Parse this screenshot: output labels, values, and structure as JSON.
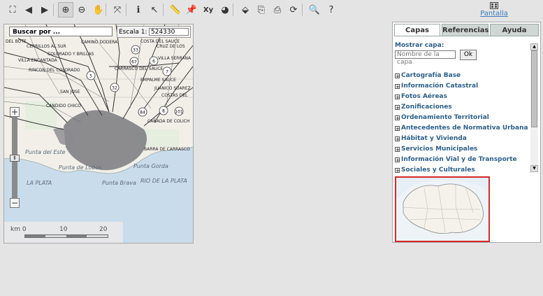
{
  "toolbar": {
    "buttons": [
      {
        "name": "extent-icon",
        "glyph": "⛶"
      },
      {
        "name": "back-arrow-icon",
        "glyph": "◀"
      },
      {
        "name": "forward-arrow-icon",
        "glyph": "▶"
      },
      {
        "name": "zoom-in-icon",
        "glyph": "⊕"
      },
      {
        "name": "zoom-out-icon",
        "glyph": "⊖"
      },
      {
        "name": "pan-hand-icon",
        "glyph": "✋"
      },
      {
        "name": "zoom-window-icon",
        "glyph": "⤧"
      },
      {
        "name": "info-icon",
        "glyph": "ℹ"
      },
      {
        "name": "select-arrow-icon",
        "glyph": "↖"
      },
      {
        "name": "measure-ruler-icon",
        "glyph": "📏"
      },
      {
        "name": "pushpin-icon",
        "glyph": "📌"
      },
      {
        "name": "coordinates-icon",
        "glyph": "Xy"
      },
      {
        "name": "globe-icon",
        "glyph": "◕"
      },
      {
        "name": "fill-bucket-icon",
        "glyph": "⬙"
      },
      {
        "name": "export-icon",
        "glyph": "⎘"
      },
      {
        "name": "print-icon",
        "glyph": "⎙"
      },
      {
        "name": "refresh-icon",
        "glyph": "⟳"
      },
      {
        "name": "search-globe-icon",
        "glyph": "🔍"
      },
      {
        "name": "help-icon",
        "glyph": "?"
      }
    ],
    "pantalla_label": "Pantalla"
  },
  "map": {
    "search_label": "Buscar por ...",
    "scale_label": "Escala 1:",
    "scale_value": "524330",
    "places": [
      "DEL BOTE",
      "CERRILLOS AL SUR",
      "CAMINO DODERA",
      "COSTA DEL SAUCE",
      "CRUZ DE LOS",
      "COLORADO Y BRILLAS",
      "VILLA SERRANA",
      "VILLA ENCANTADA",
      "RINCON DEL COLORADO",
      "CARRASCO DEL SAUCE",
      "EMPALME SAUCE",
      "JUANICO SUAREZ",
      "COSTAS DEL",
      "CAÑADA DE COLICH",
      "Punta del Este",
      "Punta de Lobos",
      "Punta Gorda",
      "Punta Brava",
      "RIO DE LA PLATA",
      "LA PLATA",
      "BARRA DE CARRASCO",
      "CANDIDO CHICO",
      "SAN JOSE"
    ],
    "route_numbers": [
      "33",
      "67",
      "6",
      "5",
      "32",
      "7",
      "84",
      "8",
      "101"
    ],
    "scalebar": {
      "unit": "km",
      "ticks": [
        "0",
        "10",
        "20"
      ]
    }
  },
  "panel": {
    "tabs": [
      {
        "label": "Capas",
        "active": true
      },
      {
        "label": "Referencias",
        "active": false
      },
      {
        "label": "Ayuda",
        "active": false
      }
    ],
    "show_layer_label": "Mostrar capa:",
    "layer_name_placeholder": "Nombre de la capa",
    "ok_label": "Ok",
    "layers": [
      "Cartografía Base",
      "Información Catastral",
      "Fotos Aéreas",
      "Zonificaciones",
      "Ordenamiento Territorial",
      "Antecedentes de Normativa Urbana",
      "Hábitat y Vivienda",
      "Servicios Municipales",
      "Información Vial y de Transporte",
      "Sociales y Culturales"
    ]
  },
  "colors": {
    "water": "#c9dcec",
    "land": "#f1efe8",
    "urban": "#6f6f73",
    "road": "#3a3a3a",
    "link": "#2a5f8a",
    "overview_border": "#d62828"
  }
}
